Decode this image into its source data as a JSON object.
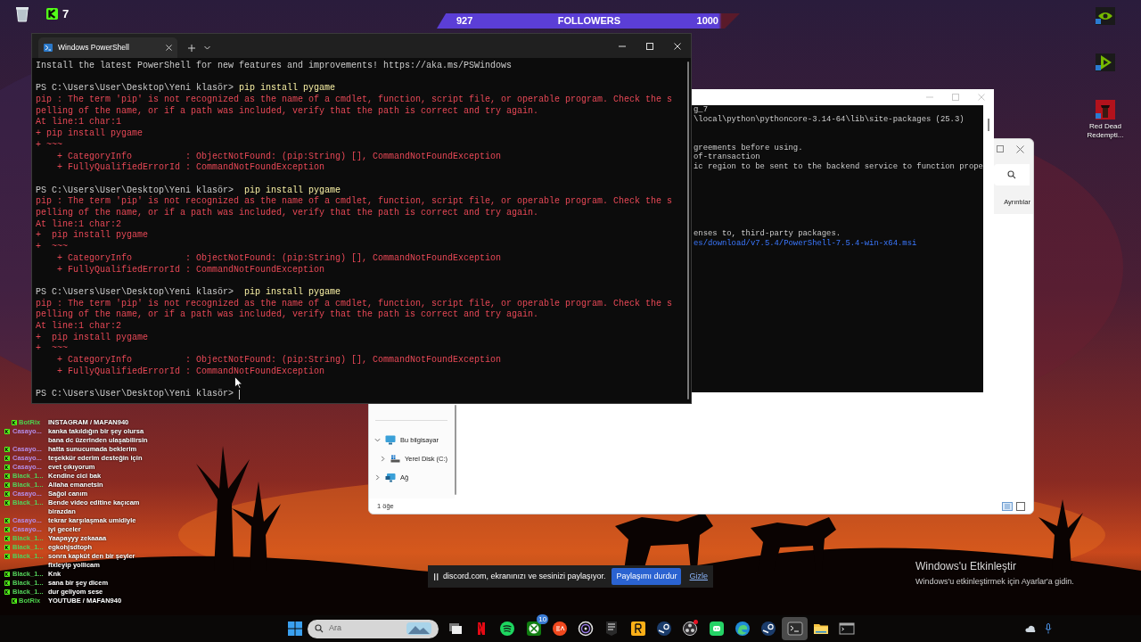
{
  "overlay": {
    "viewers": "7",
    "followers": {
      "current": "927",
      "label": "FOLLOWERS",
      "goal": "1000"
    }
  },
  "desktop_icons": [
    {
      "kind": "gpu"
    },
    {
      "kind": "arrow"
    },
    {
      "kind": "game",
      "label": "Red Dead Redempti..."
    }
  ],
  "powershell": {
    "tab": "Windows PowerShell",
    "lines": [
      {
        "kind": "plain",
        "text": "Install the latest PowerShell for new features and improvements! https://aka.ms/PSWindows"
      },
      {
        "kind": "blank"
      },
      {
        "kind": "prompt",
        "prompt": "PS C:\\Users\\User\\Desktop\\Yeni klasör>",
        "command": " pip install pygame",
        "cursor": false
      },
      {
        "kind": "error",
        "text": "pip : The term 'pip' is not recognized as the name of a cmdlet, function, script file, or operable program. Check the s"
      },
      {
        "kind": "error",
        "text": "pelling of the name, or if a path was included, verify that the path is correct and try again."
      },
      {
        "kind": "error",
        "text": "At line:1 char:1"
      },
      {
        "kind": "error",
        "text": "+ pip install pygame"
      },
      {
        "kind": "error",
        "text": "+ ~~~"
      },
      {
        "kind": "error",
        "text": "    + CategoryInfo          : ObjectNotFound: (pip:String) [], CommandNotFoundException"
      },
      {
        "kind": "error",
        "text": "    + FullyQualifiedErrorId : CommandNotFoundException"
      },
      {
        "kind": "blank"
      },
      {
        "kind": "prompt",
        "prompt": "PS C:\\Users\\User\\Desktop\\Yeni klasör>",
        "command": "  pip install pygame",
        "cursor": false
      },
      {
        "kind": "error",
        "text": "pip : The term 'pip' is not recognized as the name of a cmdlet, function, script file, or operable program. Check the s"
      },
      {
        "kind": "error",
        "text": "pelling of the name, or if a path was included, verify that the path is correct and try again."
      },
      {
        "kind": "error",
        "text": "At line:1 char:2"
      },
      {
        "kind": "error",
        "text": "+  pip install pygame"
      },
      {
        "kind": "error",
        "text": "+  ~~~"
      },
      {
        "kind": "error",
        "text": "    + CategoryInfo          : ObjectNotFound: (pip:String) [], CommandNotFoundException"
      },
      {
        "kind": "error",
        "text": "    + FullyQualifiedErrorId : CommandNotFoundException"
      },
      {
        "kind": "blank"
      },
      {
        "kind": "prompt",
        "prompt": "PS C:\\Users\\User\\Desktop\\Yeni klasör>",
        "command": "  pip install pygame",
        "cursor": false
      },
      {
        "kind": "error",
        "text": "pip : The term 'pip' is not recognized as the name of a cmdlet, function, script file, or operable program. Check the s"
      },
      {
        "kind": "error",
        "text": "pelling of the name, or if a path was included, verify that the path is correct and try again."
      },
      {
        "kind": "error",
        "text": "At line:1 char:2"
      },
      {
        "kind": "error",
        "text": "+  pip install pygame"
      },
      {
        "kind": "error",
        "text": "+  ~~~"
      },
      {
        "kind": "error",
        "text": "    + CategoryInfo          : ObjectNotFound: (pip:String) [], CommandNotFoundException"
      },
      {
        "kind": "error",
        "text": "    + FullyQualifiedErrorId : CommandNotFoundException"
      },
      {
        "kind": "blank"
      },
      {
        "kind": "prompt",
        "prompt": "PS C:\\Users\\User\\Desktop\\Yeni klasör>",
        "cursor": true
      }
    ]
  },
  "background_terminal": {
    "lines": [
      {
        "kind": "plain",
        "text": "g_7"
      },
      {
        "kind": "plain",
        "text": "\\local\\python\\pythoncore-3.14-64\\lib\\site-packages (25.3)"
      },
      {
        "kind": "blank"
      },
      {
        "kind": "blank"
      },
      {
        "kind": "plain",
        "text": "greements before using."
      },
      {
        "kind": "plain",
        "text": "of-transaction"
      },
      {
        "kind": "plain",
        "text": "ic region to be sent to the backend service to function prope"
      },
      {
        "kind": "blank"
      },
      {
        "kind": "blank"
      },
      {
        "kind": "blank"
      },
      {
        "kind": "blank"
      },
      {
        "kind": "blank"
      },
      {
        "kind": "blank"
      },
      {
        "kind": "plain",
        "text": "enses to, third-party packages."
      },
      {
        "kind": "link",
        "text": "es/download/v7.5.4/PowerShell-7.5.4-win-x64.msi"
      }
    ]
  },
  "explorer": {
    "details_button": "Ayrıntılar",
    "status": "1 öğe",
    "nav": [
      {
        "label": "Bu bilgisayar",
        "kind": "computer",
        "expanded": true,
        "children": [
          {
            "label": "Yerel Disk (C:)",
            "kind": "disk",
            "expanded": false
          }
        ]
      },
      {
        "label": "Ağ",
        "kind": "network",
        "expanded": false
      }
    ]
  },
  "chat": [
    {
      "kind": "bot",
      "user": "BotRix",
      "color": "#4ccf4c",
      "message": "INSTAGRAM / MAFAN940"
    },
    {
      "kind": "user",
      "user": "Casayo...",
      "color": "#b48ce6",
      "message": "kanka takıldığın bir şey olursa bana dc üzerinden ulaşabilirsin"
    },
    {
      "kind": "user",
      "user": "Casayo...",
      "color": "#b48ce6",
      "message": "hatta sunucumada beklerim"
    },
    {
      "kind": "user",
      "user": "Casayo...",
      "color": "#b48ce6",
      "message": "teşekkür ederim desteğin için"
    },
    {
      "kind": "user",
      "user": "Casayo...",
      "color": "#b48ce6",
      "message": "evet çıkıyorum"
    },
    {
      "kind": "user",
      "user": "Black_1...",
      "color": "#53d15a",
      "message": "Kendine cici bak"
    },
    {
      "kind": "user",
      "user": "Black_1...",
      "color": "#53d15a",
      "message": "Allaha emanetsin"
    },
    {
      "kind": "user",
      "user": "Casayo...",
      "color": "#b48ce6",
      "message": "Sağol canım"
    },
    {
      "kind": "user",
      "user": "Black_1...",
      "color": "#53d15a",
      "message": "Bende video editine kaçıcam birazdan"
    },
    {
      "kind": "user",
      "user": "Casayo...",
      "color": "#b48ce6",
      "message": "tekrar karşılaşmak umidiyle"
    },
    {
      "kind": "user",
      "user": "Casayo...",
      "color": "#b48ce6",
      "message": "iyi geceler"
    },
    {
      "kind": "user",
      "user": "Black_1...",
      "color": "#53d15a",
      "message": "Yaapayyy zekaaaa"
    },
    {
      "kind": "user",
      "user": "Black_1...",
      "color": "#53d15a",
      "message": "egkohjsdtoph"
    },
    {
      "kind": "user",
      "user": "Black_1...",
      "color": "#53d15a",
      "message": "sonra kapküt den bir şeyler fixleyip yollicam"
    },
    {
      "kind": "user",
      "user": "Black_1...",
      "color": "#53d15a",
      "message": "Knk"
    },
    {
      "kind": "user",
      "user": "Black_1...",
      "color": "#53d15a",
      "message": "sana bir şey dicem"
    },
    {
      "kind": "user",
      "user": "Black_1...",
      "color": "#53d15a",
      "message": "dur geliyom sese"
    },
    {
      "kind": "bot",
      "user": "BotRix",
      "color": "#4ccf4c",
      "message": "YOUTUBE / MAFAN940"
    }
  ],
  "share_bar": {
    "message": "discord.com, ekranınızı ve sesinizi paylaşıyor.",
    "stop_button": "Paylaşımı durdur",
    "hide_link": "Gizle"
  },
  "activation": {
    "title": "Windows'u Etkinleştir",
    "subtitle": "Windows'u etkinleştirmek için Ayarlar'a gidin."
  },
  "taskbar": {
    "search_placeholder": "Ara",
    "apps": [
      {
        "kind": "taskview",
        "active": false,
        "alert": false
      },
      {
        "kind": "netflix",
        "active": false,
        "alert": false
      },
      {
        "kind": "spotify",
        "active": false,
        "alert": false
      },
      {
        "kind": "xbox",
        "active": false,
        "alert": false,
        "badge": "10"
      },
      {
        "kind": "ea",
        "active": false,
        "alert": false
      },
      {
        "kind": "ubisoft",
        "active": false,
        "alert": false
      },
      {
        "kind": "epic",
        "active": false,
        "alert": false
      },
      {
        "kind": "rockstar",
        "active": false,
        "alert": false
      },
      {
        "kind": "steam",
        "active": false,
        "alert": false
      },
      {
        "kind": "obs",
        "active": false,
        "alert": true
      },
      {
        "kind": "whatsapp",
        "active": false,
        "alert": false
      },
      {
        "kind": "edge",
        "active": false,
        "alert": false
      },
      {
        "kind": "steam",
        "active": false,
        "alert": false
      },
      {
        "kind": "terminal",
        "active": true,
        "alert": false
      },
      {
        "kind": "folder",
        "active": false,
        "alert": false
      },
      {
        "kind": "console",
        "active": false,
        "alert": false
      }
    ]
  }
}
